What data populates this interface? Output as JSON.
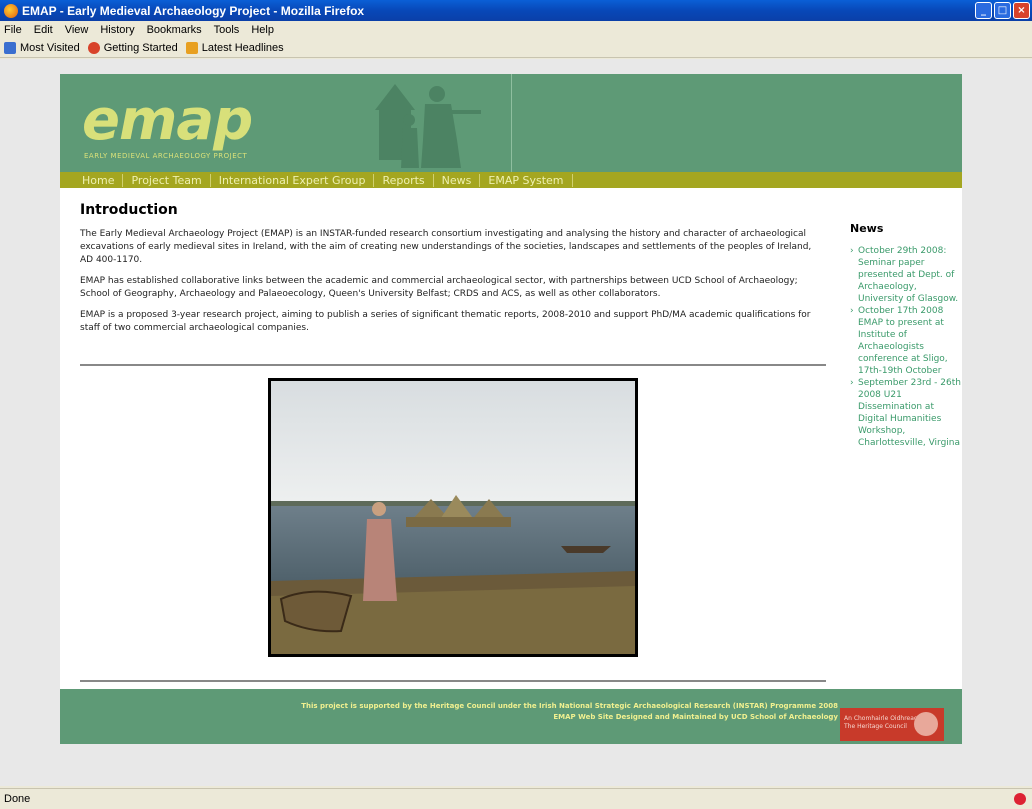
{
  "window": {
    "title": "EMAP - Early Medieval Archaeology Project - Mozilla Firefox"
  },
  "menu": [
    "File",
    "Edit",
    "View",
    "History",
    "Bookmarks",
    "Tools",
    "Help"
  ],
  "bookmarks": [
    {
      "label": "Most Visited",
      "icon": "blue-page-icon",
      "color": "#3b6fcf"
    },
    {
      "label": "Getting Started",
      "icon": "firefox-icon",
      "color": "#d8432a"
    },
    {
      "label": "Latest Headlines",
      "icon": "rss-icon",
      "color": "#e8a020"
    }
  ],
  "site": {
    "logo": "emap",
    "logo_sub": "EARLY MEDIEVAL ARCHAEOLOGY PROJECT",
    "nav": [
      "Home",
      "Project Team",
      "International Expert Group",
      "Reports",
      "News",
      "EMAP System"
    ],
    "intro_title": "Introduction",
    "paragraphs": [
      "The Early Medieval Archaeology Project (EMAP) is an INSTAR-funded research consortium investigating and analysing the history and character of archaeological excavations of early medieval sites in Ireland, with the aim of creating new understandings of the societies, landscapes and settlements of the peoples of Ireland, AD 400-1170.",
      "EMAP has established collaborative links between the academic and commercial archaeological sector, with partnerships between UCD School of Archaeology; School of Geography, Archaeology and Palaeoecology, Queen's University Belfast; CRDS and ACS, as well as other collaborators.",
      "EMAP is a proposed 3-year research project, aiming to publish a series of significant thematic reports, 2008-2010 and support PhD/MA academic qualifications for staff of two commercial archaeological companies."
    ],
    "news_title": "News",
    "news": [
      "October 29th 2008: Seminar paper presented at Dept. of Archaeology, University of Glasgow.",
      "October 17th 2008 EMAP to present at Institute of Archaeologists conference at Sligo, 17th-19th October",
      "September 23rd - 26th 2008 U21 Dissemination at Digital Humanities Workshop, Charlottesville, Virgina"
    ],
    "footer_line1": "This project is supported by the Heritage Council under the Irish National Strategic Archaeological Research (INSTAR) Programme 2008",
    "footer_line2": "EMAP Web Site Designed and Maintained by UCD School of Archaeology",
    "heritage_line1": "An Chomhairle Oidhreachta",
    "heritage_line2": "The Heritage Council"
  },
  "status": "Done"
}
